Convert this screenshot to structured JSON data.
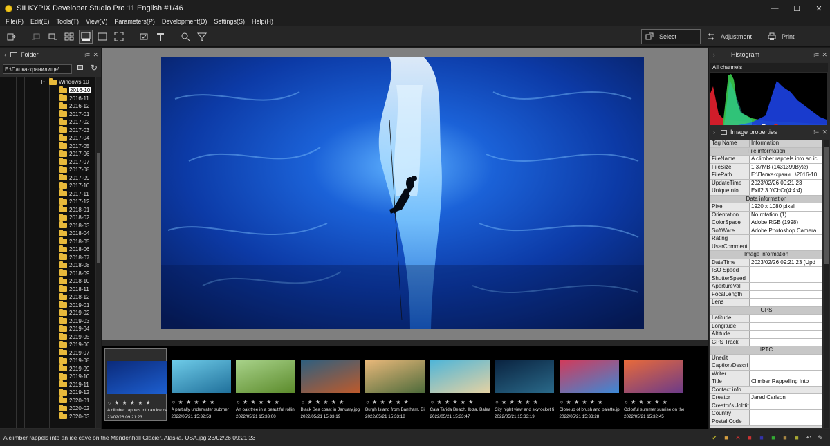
{
  "window": {
    "title": "SILKYPIX Developer Studio Pro 11 English   #1/46"
  },
  "menu": [
    "File(F)",
    "Edit(E)",
    "Tools(T)",
    "View(V)",
    "Parameters(P)",
    "Development(D)",
    "Settings(S)",
    "Help(H)"
  ],
  "modes": {
    "select": "Select",
    "adjustment": "Adjustment",
    "print": "Print"
  },
  "folder_panel": {
    "title": "Folder",
    "path": "E:\\Папка-хранилище\\",
    "root": "Windows 10",
    "folders": [
      "2016-10",
      "2016-11",
      "2016-12",
      "2017-01",
      "2017-02",
      "2017-03",
      "2017-04",
      "2017-05",
      "2017-06",
      "2017-07",
      "2017-08",
      "2017-09",
      "2017-10",
      "2017-11",
      "2017-12",
      "2018-01",
      "2018-02",
      "2018-03",
      "2018-04",
      "2018-05",
      "2018-06",
      "2018-07",
      "2018-08",
      "2018-09",
      "2018-10",
      "2018-11",
      "2018-12",
      "2019-01",
      "2019-02",
      "2019-03",
      "2019-04",
      "2019-05",
      "2019-06",
      "2019-07",
      "2019-08",
      "2019-09",
      "2019-10",
      "2019-11",
      "2019-12",
      "2020-01",
      "2020-02",
      "2020-03"
    ]
  },
  "filmstrip": [
    {
      "name": "A climber rappels into an ice ca",
      "date": "23/02/26 09:21:23",
      "colors": [
        "#0b2a7a",
        "#1d5fd0"
      ]
    },
    {
      "name": "A partially underwater submer",
      "date": "2022/05/21 15:32:53",
      "colors": [
        "#6ecbe8",
        "#1f6f9a"
      ]
    },
    {
      "name": "An oak tree in a beautiful rollin",
      "date": "2022/05/21 15:33:00",
      "colors": [
        "#a8d28a",
        "#5b8a2a"
      ]
    },
    {
      "name": "Black Sea coast in January.jpg",
      "date": "2022/05/21 15:33:19",
      "colors": [
        "#2e5f7f",
        "#c05a2a"
      ]
    },
    {
      "name": "Burgh Island from Bantham, Bi",
      "date": "2022/05/21 15:33:18",
      "colors": [
        "#e8b87a",
        "#4c6a3a"
      ]
    },
    {
      "name": "Cala Tarida Beach, Ibiza, Balea",
      "date": "2022/05/21 15:33:47",
      "colors": [
        "#4fb5d8",
        "#e6d2a2"
      ]
    },
    {
      "name": "City night view and skyrocket fi",
      "date": "2022/05/21 15:33:19",
      "colors": [
        "#0a2340",
        "#2a6a8a"
      ]
    },
    {
      "name": "Closeup of brush and palette.jp",
      "date": "2022/05/21 15:33:28",
      "colors": [
        "#d23a5a",
        "#3a8ad8"
      ]
    },
    {
      "name": "Colorful summer sunrise on the",
      "date": "2022/05/21 15:32:45",
      "colors": [
        "#e86a3a",
        "#6a3a8a"
      ]
    }
  ],
  "stars_text": "○ ★ ★ ★ ★ ★",
  "histogram": {
    "title": "Histogram",
    "channel": "All channels"
  },
  "image_properties": {
    "title": "Image properties",
    "col_tag": "Tag Name",
    "col_info": "Information",
    "sec_file": "File information",
    "filename_k": "FileName",
    "filename_v": "A climber rappels into an ic",
    "filesize_k": "FileSize",
    "filesize_v": "1.37MB (1431399Byte)",
    "filepath_k": "FilePath",
    "filepath_v": "E:\\Папка-храни...\\2016-10",
    "update_k": "UpdateTime",
    "update_v": "2023/02/26 09:21:23",
    "unique_k": "UniqueInfo",
    "unique_v": "Exif2.3 YCbCr(4:4:4)",
    "sec_data": "Data information",
    "pixel_k": "Pixel",
    "pixel_v": "1920 x 1080 pixel",
    "orient_k": "Orientation",
    "orient_v": "No rotation (1)",
    "cs_k": "ColorSpace",
    "cs_v": "Adobe RGB (1998)",
    "sw_k": "SoftWare",
    "sw_v": "Adobe Photoshop Camera",
    "rating_k": "Rating",
    "rating_v": "",
    "uc_k": "UserComment",
    "uc_v": "",
    "sec_image": "Image information",
    "dt_k": "DateTime",
    "dt_v": "2023/02/26 09:21:23 (Upd",
    "iso_k": "ISO Speed",
    "iso_v": "",
    "ss_k": "ShutterSpeed",
    "ss_v": "",
    "ap_k": "ApertureVal",
    "ap_v": "",
    "fl_k": "FocalLength",
    "fl_v": "",
    "lens_k": "Lens",
    "lens_v": "",
    "sec_gps": "GPS",
    "lat_k": "Latitude",
    "lat_v": "",
    "lon_k": "Longitude",
    "lon_v": "",
    "alt_k": "Altitude",
    "alt_v": "",
    "track_k": "GPS Track",
    "track_v": "",
    "sec_iptc": "IPTC",
    "unedit_k": "Unedit",
    "unedit_v": "",
    "cap_k": "Caption/Descri",
    "cap_v": "",
    "writer_k": "Writer",
    "writer_v": "",
    "title_k": "Title",
    "title_v": "Climber Rappelling Into I",
    "contact_k": "Contact info",
    "creator_k": "Creator",
    "creator_v": "Jared Carlson",
    "cjob_k": "Creator's Jobtit",
    "cjob_v": "",
    "country_k": "Country",
    "country_v": "",
    "postal_k": "Postal Code",
    "postal_v": ""
  },
  "status": {
    "text": "A climber rappels into an ice cave on the Mendenhall Glacier, Alaska, USA.jpg 23/02/26 09:21:23"
  }
}
